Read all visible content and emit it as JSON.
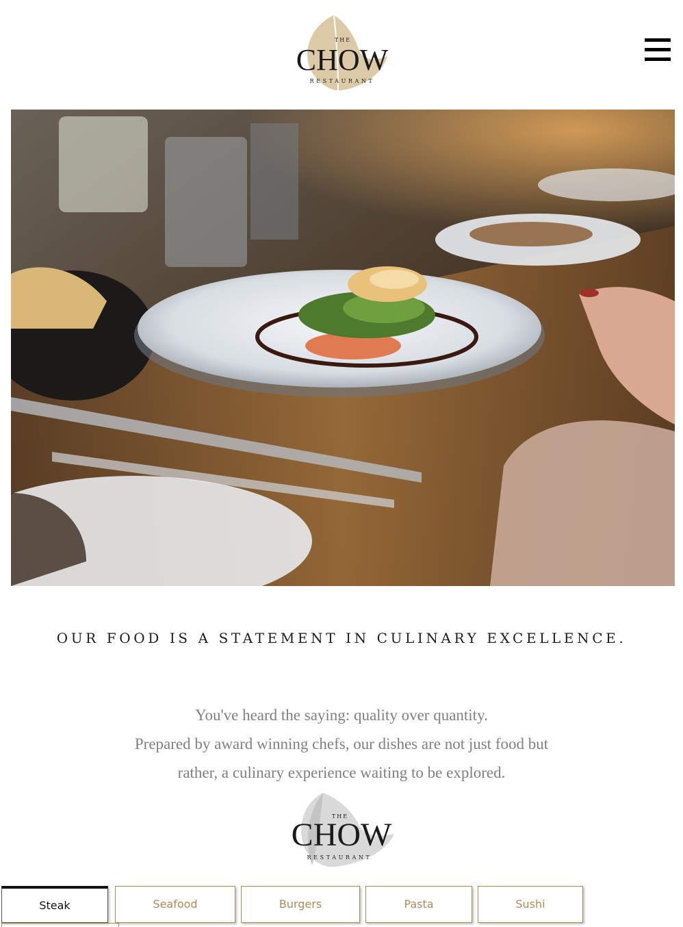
{
  "header": {
    "logo": {
      "the": "THE",
      "name": "CHOW",
      "sub": "RESTAURANT"
    },
    "menu_icon": "hamburger-menu-icon"
  },
  "hero": {
    "image": "plated-fish-dish-photo"
  },
  "content": {
    "statement": "OUR FOOD IS A STATEMENT IN CULINARY EXCELLENCE.",
    "intro_lines": [
      "You've heard the saying: quality over quantity.",
      "Prepared by award winning chefs, our dishes are not just food but",
      "rather, a culinary experience waiting to be explored."
    ],
    "logo": {
      "the": "THE",
      "name": "CHOW",
      "sub": "RESTAURANT"
    }
  },
  "tabs": [
    {
      "label": "Steak",
      "active": true
    },
    {
      "label": "Seafood",
      "active": false
    },
    {
      "label": "Burgers",
      "active": false
    },
    {
      "label": "Pasta",
      "active": false
    },
    {
      "label": "Sushi",
      "active": false
    }
  ],
  "colors": {
    "accent": "#b08a55",
    "leaf": "#dcc9a6",
    "leaf_grey": "#d9d9d9",
    "text_dark": "#1d1d1d",
    "text_grey": "#808080"
  }
}
